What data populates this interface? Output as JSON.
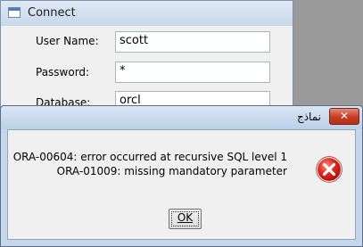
{
  "connect_window": {
    "title": "Connect",
    "fields": [
      {
        "label": "User Name:",
        "value": "scott"
      },
      {
        "label": "Password:",
        "value": "*"
      },
      {
        "label": "Database:",
        "value": "orcl"
      }
    ]
  },
  "error_dialog": {
    "title": "نماذج",
    "close_label": "✕",
    "message_lines": [
      "ORA-00604: error occurred at recursive SQL level 1",
      "ORA-01009: missing mandatory parameter"
    ],
    "ok_label": "OK",
    "icon": "error-icon"
  }
}
